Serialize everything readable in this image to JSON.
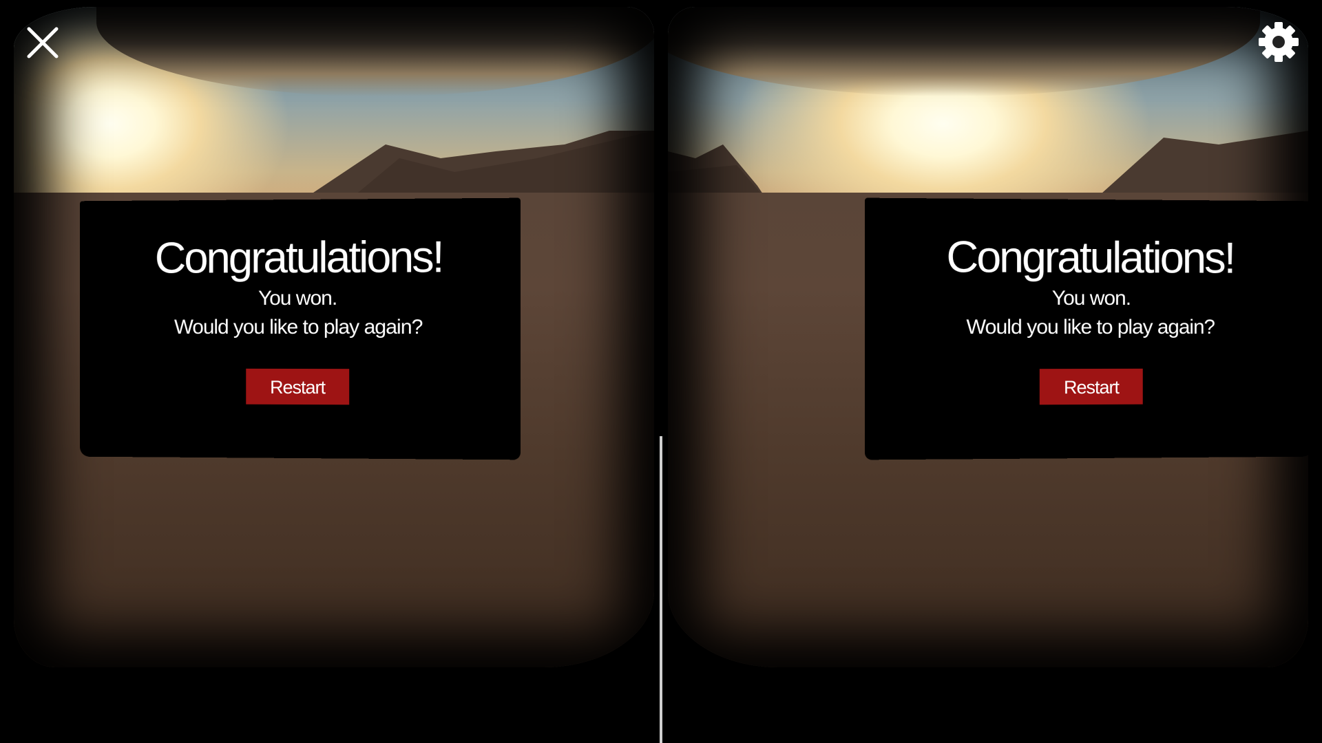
{
  "dialog": {
    "title": "Congratulations!",
    "message_line1": "You won.",
    "message_line2": "Would you like to play again?",
    "restart_label": "Restart"
  },
  "icons": {
    "close": "close-icon",
    "settings": "gear-icon"
  },
  "colors": {
    "restart_button": "#9e1414",
    "panel": "#000000",
    "divider": "#cfcfcf"
  }
}
